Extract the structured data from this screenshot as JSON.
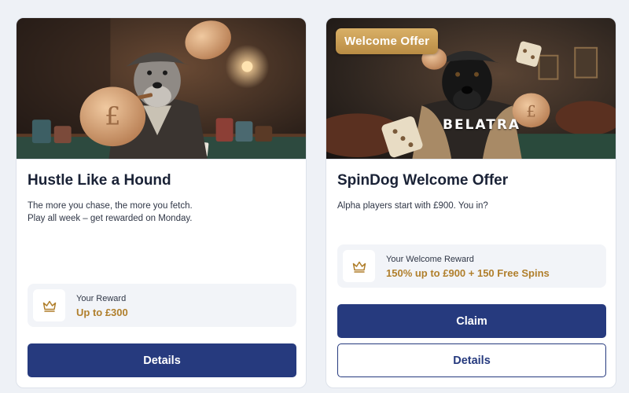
{
  "colors": {
    "page_background": "#eef1f6",
    "primary": "#263a7e",
    "reward_accent": "#b07f2c",
    "badge_gold": "#c89c55"
  },
  "cards": [
    {
      "image_icon": "poker-dog-illustration",
      "title": "Hustle Like a Hound",
      "description_lines": [
        "The more you chase, the more you fetch.",
        "Play all week – get rewarded on Monday."
      ],
      "reward": {
        "icon": "crown-icon",
        "label": "Your Reward",
        "value": "Up to £300"
      },
      "buttons": {
        "details": "Details"
      }
    },
    {
      "image_icon": "casino-dog-illustration",
      "badge": "Welcome Offer",
      "brand": "BELATRA",
      "title": "SpinDog Welcome Offer",
      "description_lines": [
        "Alpha players start with £900. You in?"
      ],
      "reward": {
        "icon": "crown-icon",
        "label": "Your Welcome Reward",
        "value": "150% up to £900 + 150 Free Spins"
      },
      "buttons": {
        "claim": "Claim",
        "details": "Details"
      }
    }
  ]
}
